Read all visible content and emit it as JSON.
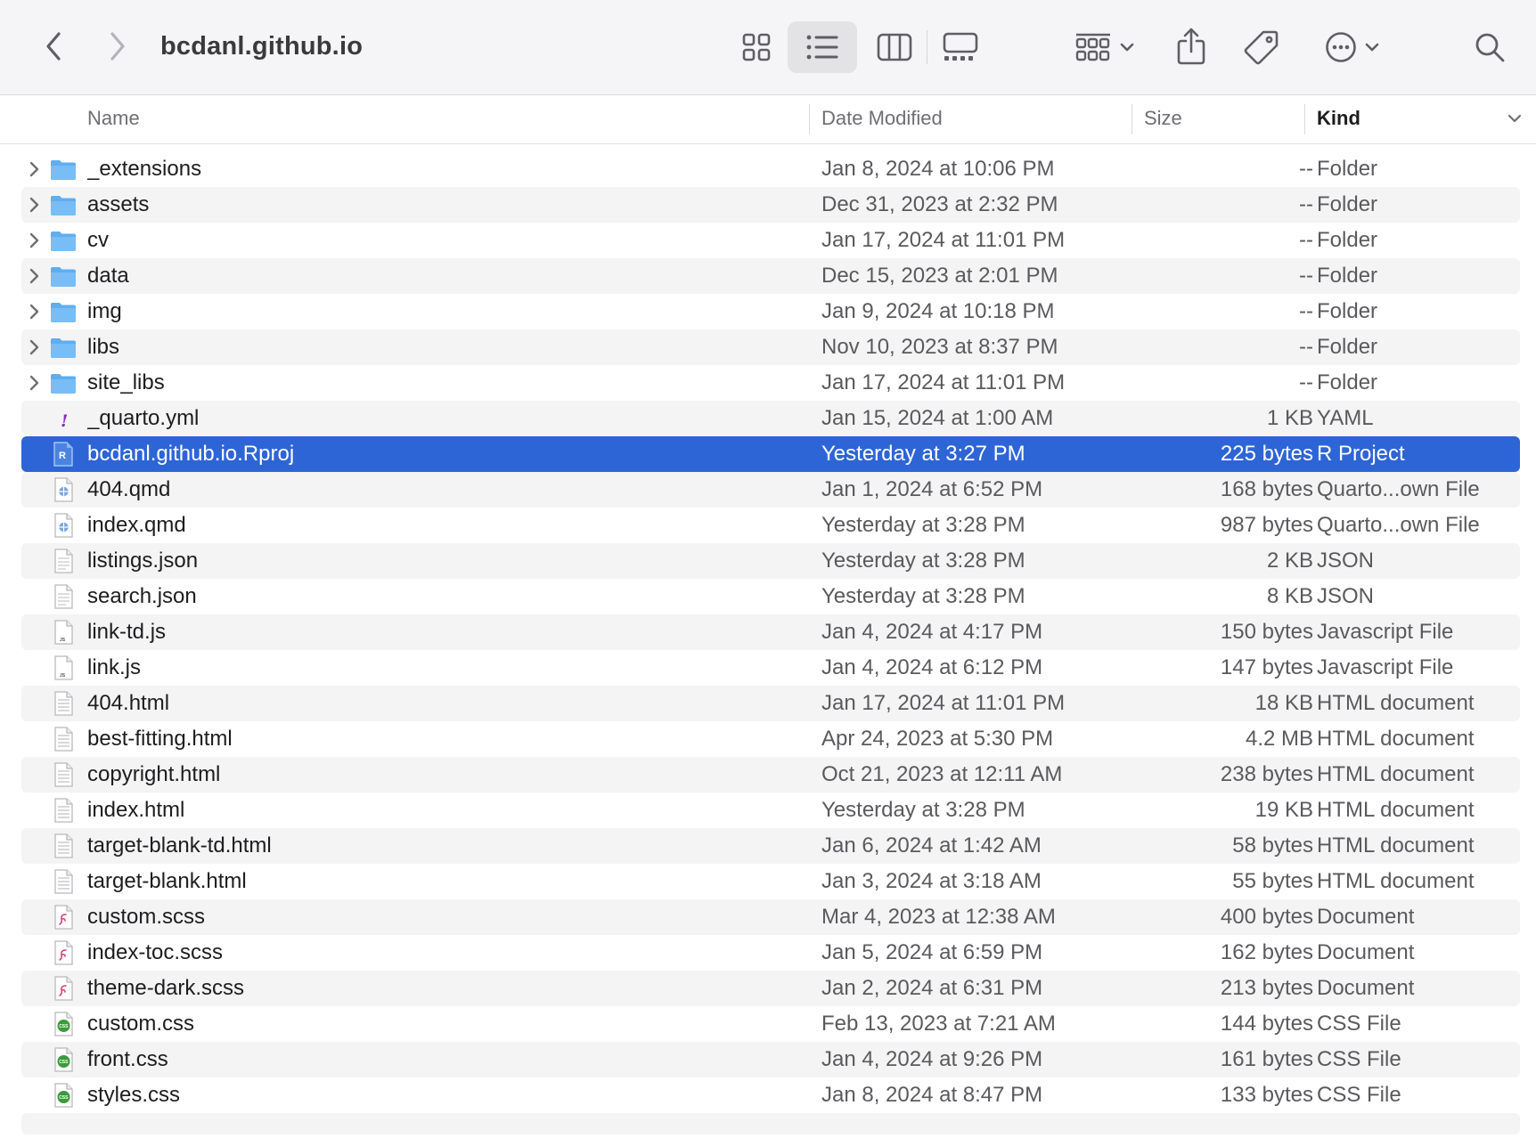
{
  "toolbar": {
    "title": "bcdanl.github.io",
    "buttons": [
      {
        "name": "back",
        "icon": "chevron-left-icon"
      },
      {
        "name": "forward",
        "icon": "chevron-right-icon"
      },
      {
        "name": "icon-view",
        "icon": "grid-icon"
      },
      {
        "name": "list-view",
        "icon": "list-icon",
        "selected": true
      },
      {
        "name": "column-view",
        "icon": "columns-icon"
      },
      {
        "name": "gallery-view",
        "icon": "gallery-icon"
      },
      {
        "name": "group",
        "icon": "group-icon"
      },
      {
        "name": "share",
        "icon": "share-icon"
      },
      {
        "name": "tags",
        "icon": "tag-icon"
      },
      {
        "name": "more",
        "icon": "ellipsis-circle-icon"
      },
      {
        "name": "search",
        "icon": "search-icon"
      }
    ]
  },
  "columns": {
    "name": "Name",
    "date": "Date Modified",
    "size": "Size",
    "kind": "Kind",
    "sorted_by": "Kind"
  },
  "colors": {
    "selection": "#2e65d6",
    "folder": "#5eaef0",
    "css_badge": "#3a9b3a",
    "scss_mark": "#cc3e6a",
    "yaml_mark": "#8a2bb8"
  },
  "files": [
    {
      "name": "_extensions",
      "date": "Jan 8, 2024 at 10:06 PM",
      "size": "--",
      "kind": "Folder",
      "icon": "folder-icon",
      "expandable": true
    },
    {
      "name": "assets",
      "date": "Dec 31, 2023 at 2:32 PM",
      "size": "--",
      "kind": "Folder",
      "icon": "folder-icon",
      "expandable": true
    },
    {
      "name": "cv",
      "date": "Jan 17, 2024 at 11:01 PM",
      "size": "--",
      "kind": "Folder",
      "icon": "folder-icon",
      "expandable": true
    },
    {
      "name": "data",
      "date": "Dec 15, 2023 at 2:01 PM",
      "size": "--",
      "kind": "Folder",
      "icon": "folder-icon",
      "expandable": true
    },
    {
      "name": "img",
      "date": "Jan 9, 2024 at 10:18 PM",
      "size": "--",
      "kind": "Folder",
      "icon": "folder-icon",
      "expandable": true
    },
    {
      "name": "libs",
      "date": "Nov 10, 2023 at 8:37 PM",
      "size": "--",
      "kind": "Folder",
      "icon": "folder-icon",
      "expandable": true
    },
    {
      "name": "site_libs",
      "date": "Jan 17, 2024 at 11:01 PM",
      "size": "--",
      "kind": "Folder",
      "icon": "folder-icon",
      "expandable": true
    },
    {
      "name": "_quarto.yml",
      "date": "Jan 15, 2024 at 1:00 AM",
      "size": "1 KB",
      "kind": "YAML",
      "icon": "yaml-file-icon"
    },
    {
      "name": "bcdanl.github.io.Rproj",
      "date": "Yesterday at 3:27 PM",
      "size": "225 bytes",
      "kind": "R Project",
      "icon": "rproj-file-icon",
      "selected": true
    },
    {
      "name": "404.qmd",
      "date": "Jan 1, 2024 at 6:52 PM",
      "size": "168 bytes",
      "kind": "Quarto...own File",
      "icon": "quarto-file-icon"
    },
    {
      "name": "index.qmd",
      "date": "Yesterday at 3:28 PM",
      "size": "987 bytes",
      "kind": "Quarto...own File",
      "icon": "quarto-file-icon"
    },
    {
      "name": "listings.json",
      "date": "Yesterday at 3:28 PM",
      "size": "2 KB",
      "kind": "JSON",
      "icon": "json-file-icon"
    },
    {
      "name": "search.json",
      "date": "Yesterday at 3:28 PM",
      "size": "8 KB",
      "kind": "JSON",
      "icon": "json-file-icon"
    },
    {
      "name": "link-td.js",
      "date": "Jan 4, 2024 at 4:17 PM",
      "size": "150 bytes",
      "kind": "Javascript File",
      "icon": "js-file-icon"
    },
    {
      "name": "link.js",
      "date": "Jan 4, 2024 at 6:12 PM",
      "size": "147 bytes",
      "kind": "Javascript File",
      "icon": "js-file-icon"
    },
    {
      "name": "404.html",
      "date": "Jan 17, 2024 at 11:01 PM",
      "size": "18 KB",
      "kind": "HTML document",
      "icon": "html-file-icon"
    },
    {
      "name": "best-fitting.html",
      "date": "Apr 24, 2023 at 5:30 PM",
      "size": "4.2 MB",
      "kind": "HTML document",
      "icon": "html-file-icon"
    },
    {
      "name": "copyright.html",
      "date": "Oct 21, 2023 at 12:11 AM",
      "size": "238 bytes",
      "kind": "HTML document",
      "icon": "html-file-icon"
    },
    {
      "name": "index.html",
      "date": "Yesterday at 3:28 PM",
      "size": "19 KB",
      "kind": "HTML document",
      "icon": "html-file-icon"
    },
    {
      "name": "target-blank-td.html",
      "date": "Jan 6, 2024 at 1:42 AM",
      "size": "58 bytes",
      "kind": "HTML document",
      "icon": "html-file-icon"
    },
    {
      "name": "target-blank.html",
      "date": "Jan 3, 2024 at 3:18 AM",
      "size": "55 bytes",
      "kind": "HTML document",
      "icon": "html-file-icon"
    },
    {
      "name": "custom.scss",
      "date": "Mar 4, 2023 at 12:38 AM",
      "size": "400 bytes",
      "kind": "Document",
      "icon": "scss-file-icon"
    },
    {
      "name": "index-toc.scss",
      "date": "Jan 5, 2024 at 6:59 PM",
      "size": "162 bytes",
      "kind": "Document",
      "icon": "scss-file-icon"
    },
    {
      "name": "theme-dark.scss",
      "date": "Jan 2, 2024 at 6:31 PM",
      "size": "213 bytes",
      "kind": "Document",
      "icon": "scss-file-icon"
    },
    {
      "name": "custom.css",
      "date": "Feb 13, 2023 at 7:21 AM",
      "size": "144 bytes",
      "kind": "CSS File",
      "icon": "css-file-icon"
    },
    {
      "name": "front.css",
      "date": "Jan 4, 2024 at 9:26 PM",
      "size": "161 bytes",
      "kind": "CSS File",
      "icon": "css-file-icon"
    },
    {
      "name": "styles.css",
      "date": "Jan 8, 2024 at 8:47 PM",
      "size": "133 bytes",
      "kind": "CSS File",
      "icon": "css-file-icon"
    }
  ]
}
